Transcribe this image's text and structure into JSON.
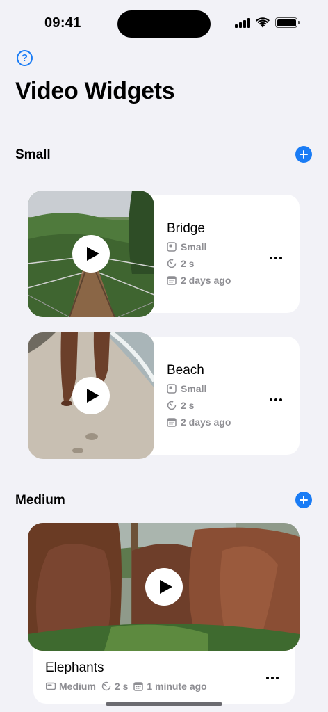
{
  "status_bar": {
    "time": "09:41"
  },
  "header": {
    "title": "Video Widgets",
    "help_icon": "question-circle-icon"
  },
  "sections": [
    {
      "title": "Small",
      "widgets": [
        {
          "title": "Bridge",
          "size": "Small",
          "duration": "2 s",
          "date": "2 days ago"
        },
        {
          "title": "Beach",
          "size": "Small",
          "duration": "2 s",
          "date": "2 days ago"
        }
      ]
    },
    {
      "title": "Medium",
      "widgets": [
        {
          "title": "Elephants",
          "size": "Medium",
          "duration": "2 s",
          "date": "1 minute ago"
        }
      ]
    }
  ],
  "colors": {
    "accent": "#1a7cf5",
    "background": "#f2f2f7",
    "card": "#ffffff",
    "secondary_text": "#8e8e93"
  }
}
